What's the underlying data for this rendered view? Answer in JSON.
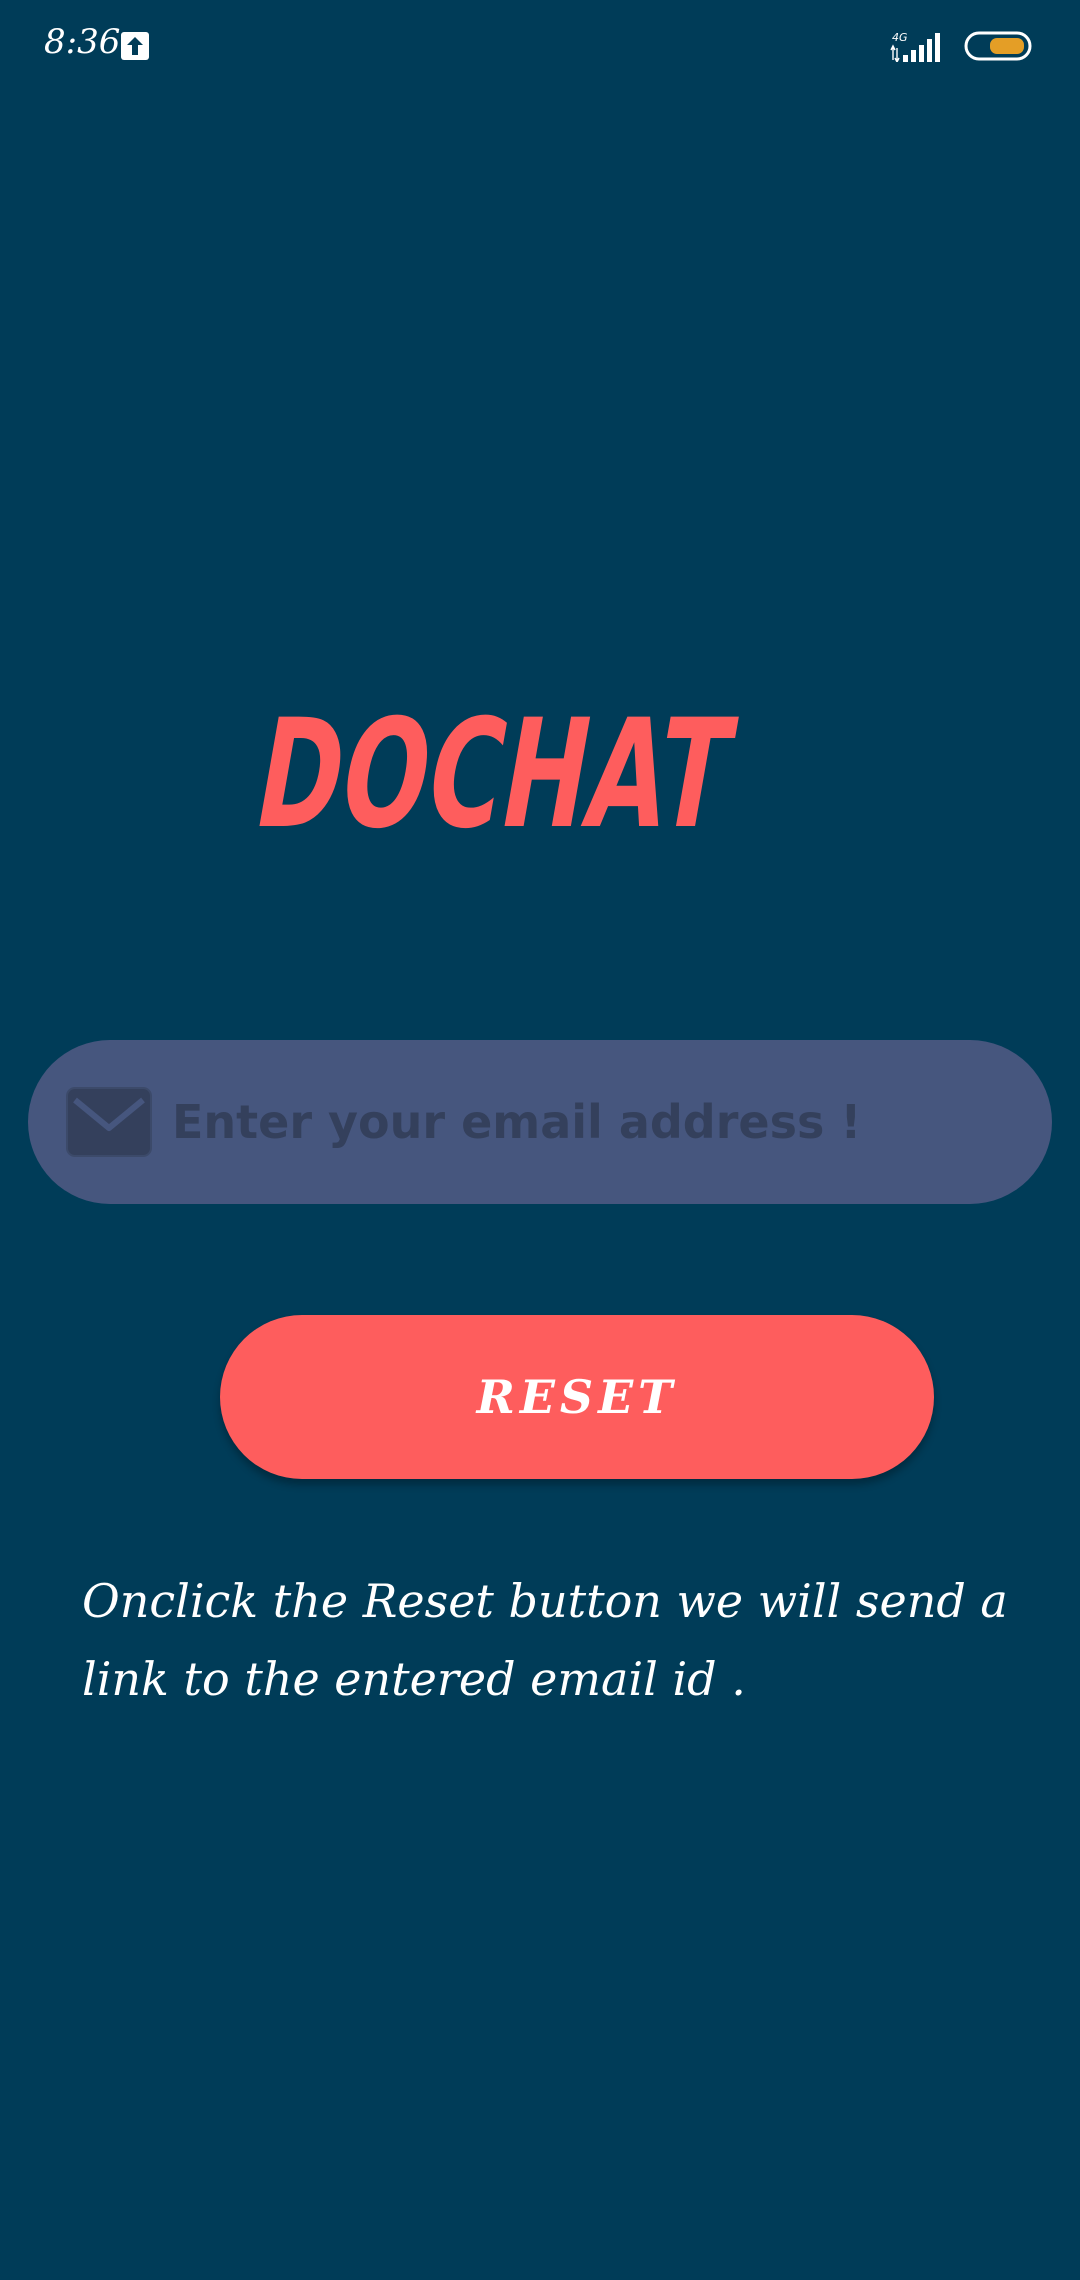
{
  "status_bar": {
    "time": "8:36",
    "network_type": "4G",
    "icons": [
      "upload-icon",
      "signal-icon",
      "battery-icon"
    ]
  },
  "app": {
    "logo_text": "DOCHAT"
  },
  "form": {
    "email_placeholder": "Enter your email address !",
    "email_value": "",
    "reset_label": "RESET",
    "info_text": "Onclick the Reset button we will send a link to the entered email id ."
  },
  "colors": {
    "background": "#003c58",
    "accent": "#fe5d5d",
    "field_background": "#46567e",
    "placeholder_text": "#34405c",
    "battery_fill": "#e49e26"
  }
}
